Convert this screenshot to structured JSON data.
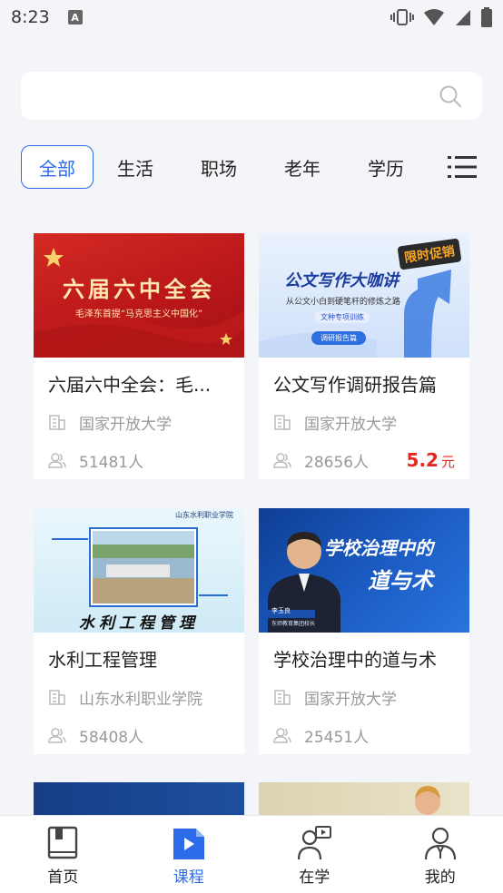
{
  "status": {
    "time": "8:23",
    "notification_badge": "A"
  },
  "search": {
    "placeholder": ""
  },
  "tabs": [
    {
      "label": "全部",
      "active": true
    },
    {
      "label": "生活",
      "active": false
    },
    {
      "label": "职场",
      "active": false
    },
    {
      "label": "老年",
      "active": false
    },
    {
      "label": "学历",
      "active": false
    }
  ],
  "courses": [
    {
      "title": "六届六中全会：毛...",
      "school": "国家开放大学",
      "students": "51481人",
      "image": {
        "headline": "六届六中全会",
        "sub": "毛泽东首提“马克思主义中国化”",
        "bg": "#c8201d"
      }
    },
    {
      "title": "公文写作调研报告篇",
      "school": "国家开放大学",
      "students": "28656人",
      "price": "5.2",
      "price_unit": "元",
      "image": {
        "headline": "公文写作大咖讲",
        "badge": "限时促销",
        "sub": "从公文小白到硬笔杆的修炼之路",
        "tag1": "文种专项训练",
        "tag2": "调研报告篇",
        "bg": "#dbe8fb"
      }
    },
    {
      "title": "水利工程管理",
      "school": "山东水利职业学院",
      "students": "58408人",
      "image": {
        "headline": "水利工程管理",
        "logo": "山东水利职业学院",
        "bg": "#dff3fb"
      }
    },
    {
      "title": "学校治理中的道与术",
      "school": "国家开放大学",
      "students": "25451人",
      "image": {
        "headline1": "学校治理中的",
        "headline2": "道与术",
        "name": "李玉良",
        "role": "东师教育集团校长",
        "bg": "#1a57b8"
      }
    }
  ],
  "bottom_nav": [
    {
      "label": "首页",
      "icon": "book-icon",
      "active": false
    },
    {
      "label": "课程",
      "icon": "play-file-icon",
      "active": true
    },
    {
      "label": "在学",
      "icon": "learning-user-icon",
      "active": false
    },
    {
      "label": "我的",
      "icon": "profile-icon",
      "active": false
    }
  ],
  "colors": {
    "accent": "#2b6bea",
    "price": "#e5281f",
    "background": "#f4f5f9"
  }
}
